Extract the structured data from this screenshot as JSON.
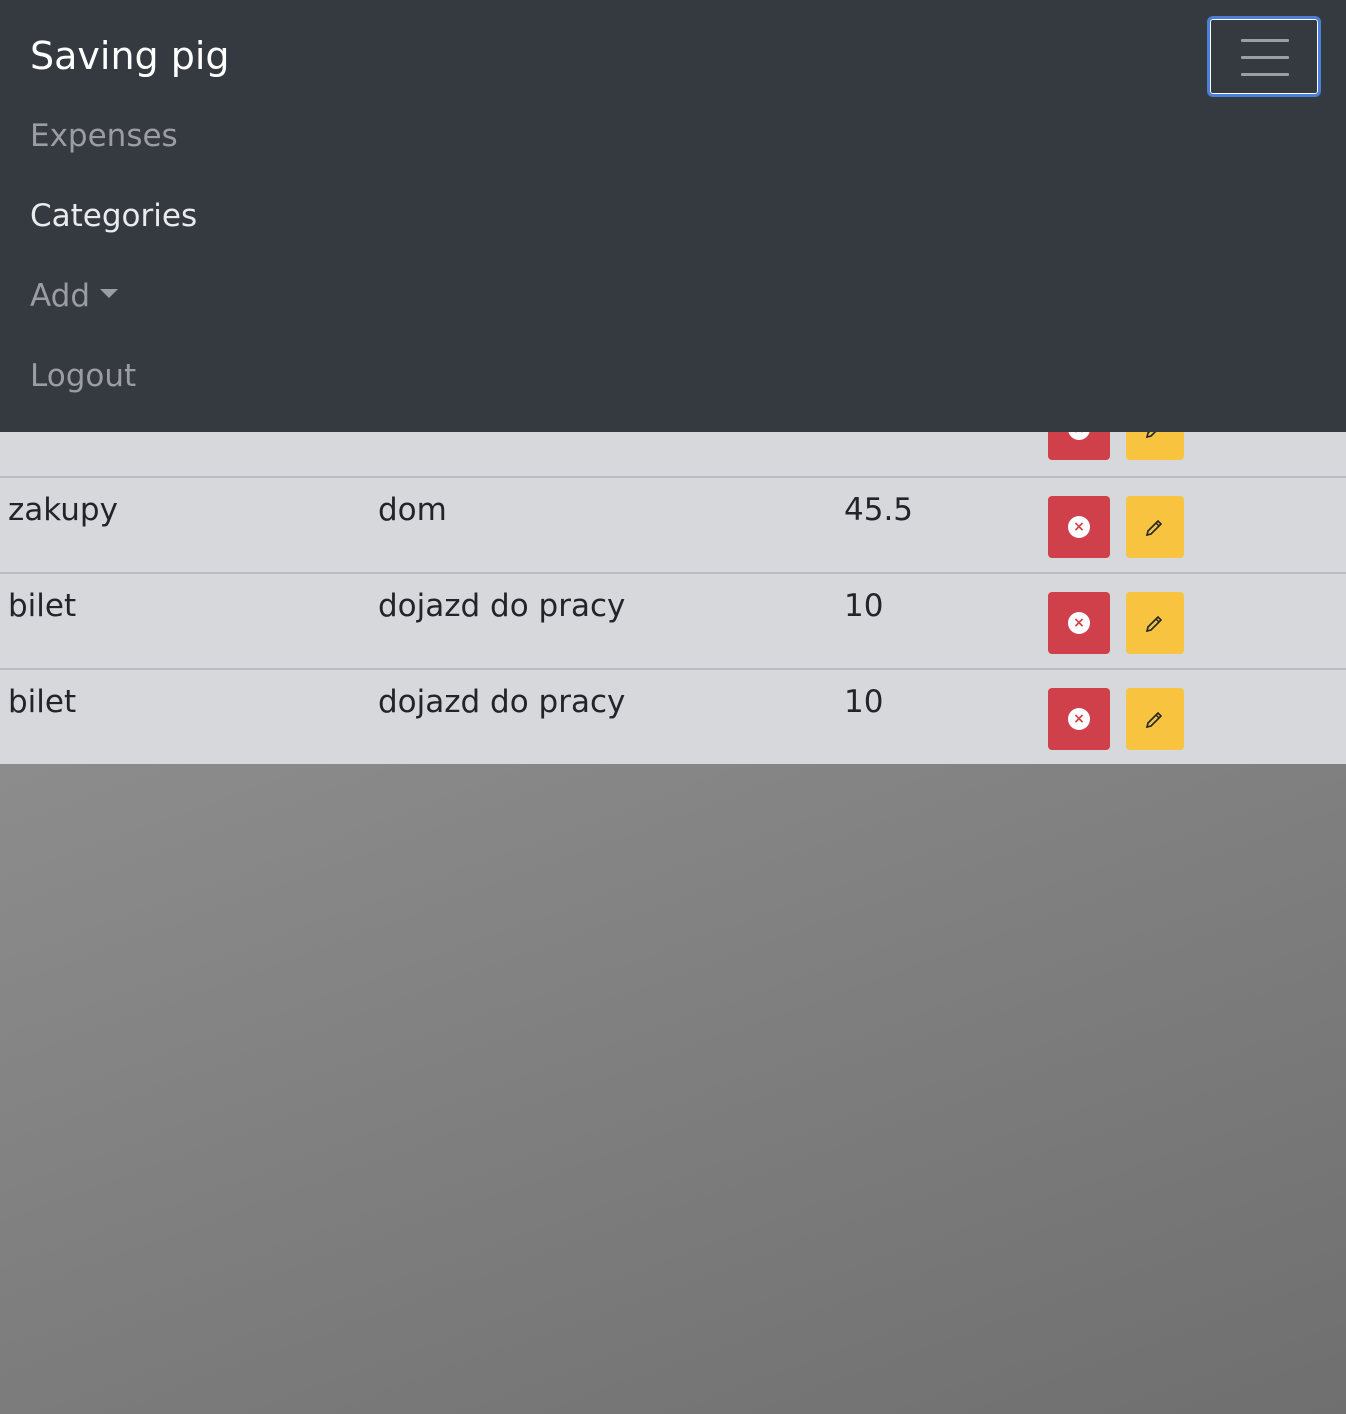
{
  "navbar": {
    "brand": "Saving pig",
    "toggler_label": "menu-toggle",
    "links": [
      {
        "label": "Expenses",
        "active": false
      },
      {
        "label": "Categories",
        "active": true
      },
      {
        "label": "Add",
        "dropdown": true,
        "active": false
      },
      {
        "label": "Logout",
        "active": false
      }
    ]
  },
  "expenses": {
    "rows": [
      {
        "name": "",
        "category": "",
        "amount": ""
      },
      {
        "name": "zakupy",
        "category": "dom",
        "amount": "45.5"
      },
      {
        "name": "bilet",
        "category": "dojazd do pracy",
        "amount": "10"
      },
      {
        "name": "bilet",
        "category": "dojazd do pracy",
        "amount": "10"
      }
    ],
    "delete_icon": "x-circle-icon",
    "edit_icon": "pencil-icon"
  },
  "colors": {
    "navbar_bg": "#343a40",
    "table_bg": "#d6d8db",
    "danger": "#d0404a",
    "warning": "#f8c440",
    "focus_ring": "#4d7fd6"
  }
}
